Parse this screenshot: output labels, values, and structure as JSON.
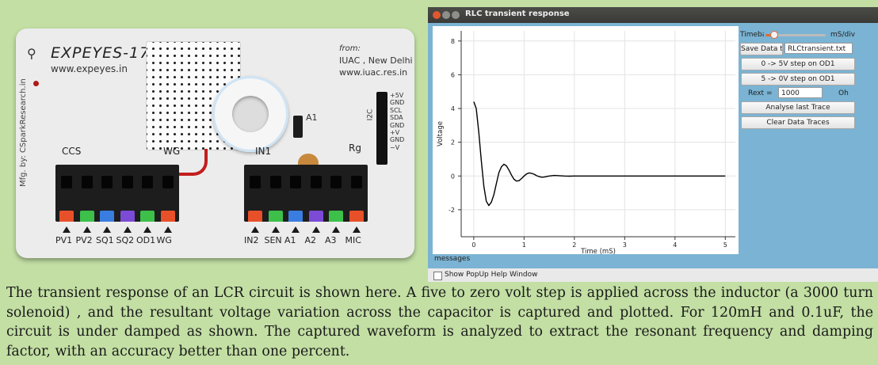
{
  "photo": {
    "brand": "EXPEYES-17",
    "website": "www.expeyes.in",
    "from_label": "from:",
    "org": "IUAC , New Delhi",
    "org_web": "www.iuac.res.in",
    "mfg": "Mfg. by: CSparkResearch.in",
    "ccs_label": "CCS",
    "wg_label": "WG",
    "in1_label": "IN1",
    "rg_label": "Rg",
    "a1_label": "A1",
    "i2c_label": "I2C",
    "i2c_pins": [
      "+5V",
      "GND",
      "SCL",
      "SDA",
      "GND",
      "+V",
      "GND",
      "−V"
    ],
    "left_pins": [
      "PV1",
      "PV2",
      "SQ1",
      "SQ2",
      "OD1",
      "WG"
    ],
    "right_pins": [
      "IN2",
      "SEN",
      "A1",
      "A2",
      "A3",
      "MIC"
    ],
    "left_lever_colors": [
      "#e8502a",
      "#3cc04a",
      "#3a7de0",
      "#7b4bd6",
      "#3cc04a",
      "#e8502a"
    ],
    "right_lever_colors": [
      "#e8502a",
      "#3cc04a",
      "#3a7de0",
      "#7b4bd6",
      "#3cc04a",
      "#e8502a"
    ]
  },
  "window": {
    "title": "RLC transient response",
    "timebase_label": "Timebase",
    "timebase_unit": "mS/div",
    "timebase_level": 0.15,
    "save_button": "Save Data to",
    "save_filename": "RLCtransient.txt",
    "step_up_button": "0 -> 5V step on OD1",
    "step_down_button": "5 -> 0V step on OD1",
    "rext_label": "Rext =",
    "rext_value": "1000",
    "rext_unit": "Oh",
    "analyse_button": "Analyse last Trace",
    "clear_button": "Clear Data  Traces",
    "messages_label": "messages",
    "popup_checkbox_label": "Show PopUp Help Window",
    "popup_checked": false
  },
  "chart_data": {
    "type": "line",
    "xlabel": "Time (mS)",
    "ylabel": "Voltage",
    "xlim": [
      -0.25,
      5.2
    ],
    "ylim": [
      -3.6,
      8.6
    ],
    "xticks": [
      0,
      1,
      2,
      3,
      4,
      5
    ],
    "yticks": [
      -2,
      0,
      2,
      4,
      6,
      8
    ],
    "grid": true,
    "series": [
      {
        "color": "#000000",
        "x": [
          0.0,
          0.05,
          0.1,
          0.15,
          0.2,
          0.25,
          0.3,
          0.35,
          0.4,
          0.45,
          0.5,
          0.55,
          0.6,
          0.65,
          0.7,
          0.75,
          0.8,
          0.85,
          0.9,
          0.95,
          1.0,
          1.05,
          1.1,
          1.15,
          1.2,
          1.25,
          1.3,
          1.35,
          1.4,
          1.45,
          1.5,
          1.6,
          1.7,
          1.8,
          1.9,
          2.0,
          2.2,
          2.5,
          3.0,
          3.5,
          4.0,
          4.5,
          5.0
        ],
        "y": [
          4.4,
          4.0,
          2.6,
          0.9,
          -0.6,
          -1.5,
          -1.75,
          -1.55,
          -1.1,
          -0.45,
          0.2,
          0.55,
          0.7,
          0.6,
          0.35,
          0.05,
          -0.2,
          -0.3,
          -0.28,
          -0.15,
          0.0,
          0.12,
          0.18,
          0.16,
          0.1,
          0.02,
          -0.04,
          -0.07,
          -0.06,
          -0.03,
          0.0,
          0.03,
          0.02,
          0.0,
          -0.01,
          0.0,
          0.0,
          0.0,
          0.0,
          0.0,
          0.0,
          0.0,
          0.0
        ]
      }
    ]
  },
  "caption": "The transient response of an LCR circuit is shown here. A five to zero volt step is applied across the inductor (a 3000 turn solenoid) , and the resultant voltage variation across the capacitor is captured and plotted. For 120mH and 0.1uF, the circuit is under damped as shown. The captured waveform is analyzed to extract the resonant frequency and damping factor, with an accuracy better than one percent."
}
